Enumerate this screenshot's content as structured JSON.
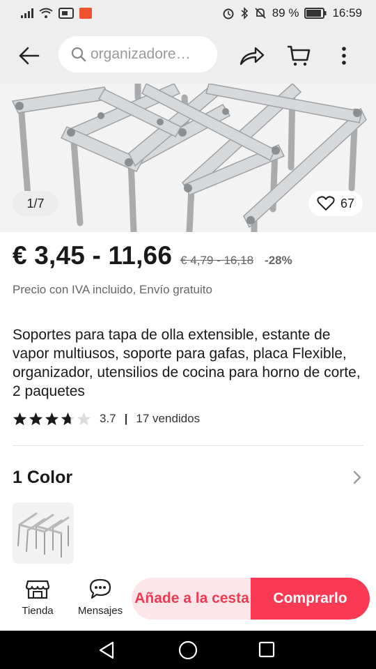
{
  "status": {
    "battery_pct": "89 %",
    "time": "16:59"
  },
  "toolbar": {
    "search_text": "organizadore…"
  },
  "gallery": {
    "counter": "1/7",
    "wish_count": "67"
  },
  "product": {
    "price": "€ 3,45 - 11,66",
    "original_price": "€ 4,79 - 16,18",
    "discount": "-28%",
    "tax_note": "Precio con IVA incluido, Envío gratuito",
    "title": "Soportes para tapa de olla extensible, estante de vapor multiusos, soporte para gafas, placa Flexible, organizador, utensilios de cocina para horno de corte, 2 paquetes",
    "rating": "3.7",
    "rating_stars": 3.7,
    "sold": "17 vendidos"
  },
  "variants": {
    "title": "1 Color"
  },
  "actions": {
    "store_label": "Tienda",
    "messages_label": "Mensajes",
    "add_to_cart": "Añade a la cesta",
    "buy_now": "Comprarlo"
  },
  "colors": {
    "accent": "#fa3a55",
    "cart_bg": "#fde6ea",
    "cart_text": "#ef3a52"
  }
}
